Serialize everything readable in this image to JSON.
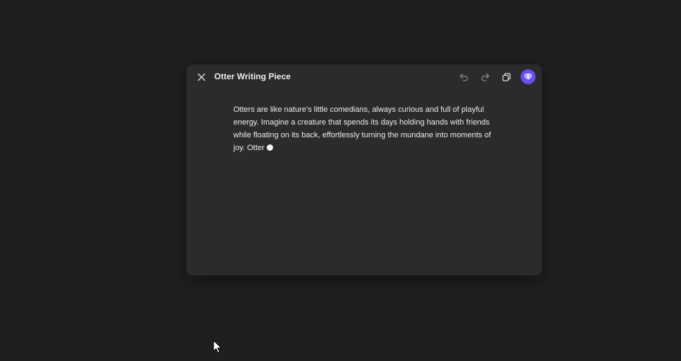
{
  "window": {
    "title": "Otter Writing Piece"
  },
  "toolbar": {
    "icons": {
      "close": "close-icon",
      "undo": "undo-icon",
      "redo": "redo-icon",
      "copy": "copy-icon",
      "gem": "gem-icon"
    }
  },
  "document": {
    "text": "Otters are like nature’s little comedians, always curious and full of playful energy. Imagine a creature that spends its days holding hands with friends while floating on its back, effortlessly turning the mundane into moments of joy. Otter"
  },
  "colors": {
    "accent": "#6a4ff5",
    "background": "#1f1f1f",
    "panel": "#2b2b2b",
    "text": "#ededed"
  }
}
